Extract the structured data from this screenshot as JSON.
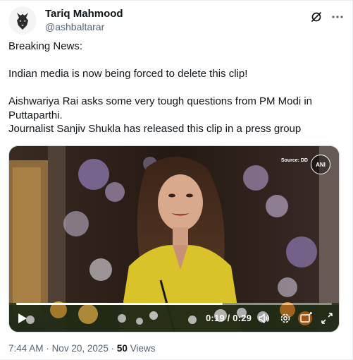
{
  "author": {
    "name": "Tariq Mahmood",
    "handle": "@ashbaltarar"
  },
  "tweet": {
    "lines": [
      "Breaking News:",
      "",
      "Indian media is now being forced to delete this clip!",
      "",
      "Aishwariya Rai asks some very tough questions from PM Modi in",
      "Puttaparthi.",
      "Journalist Sanjiv Shukla has released this clip in a press group"
    ]
  },
  "video": {
    "source_label": "Source: DD",
    "logo_text": "ANI",
    "time": "0:19 / 0:29",
    "progress": 0.655
  },
  "meta": {
    "time": "7:44 AM",
    "date": "Nov 20, 2025",
    "separator": "·",
    "views_count": "50",
    "views_label": "Views"
  },
  "icons": {
    "avatar": "wolf-logo-avatar",
    "grok": "grok-icon",
    "more": "more-icon",
    "play": "play-icon",
    "volume": "volume-icon",
    "settings": "gear-icon",
    "captions": "captions-icon",
    "fullscreen": "fullscreen-icon"
  }
}
